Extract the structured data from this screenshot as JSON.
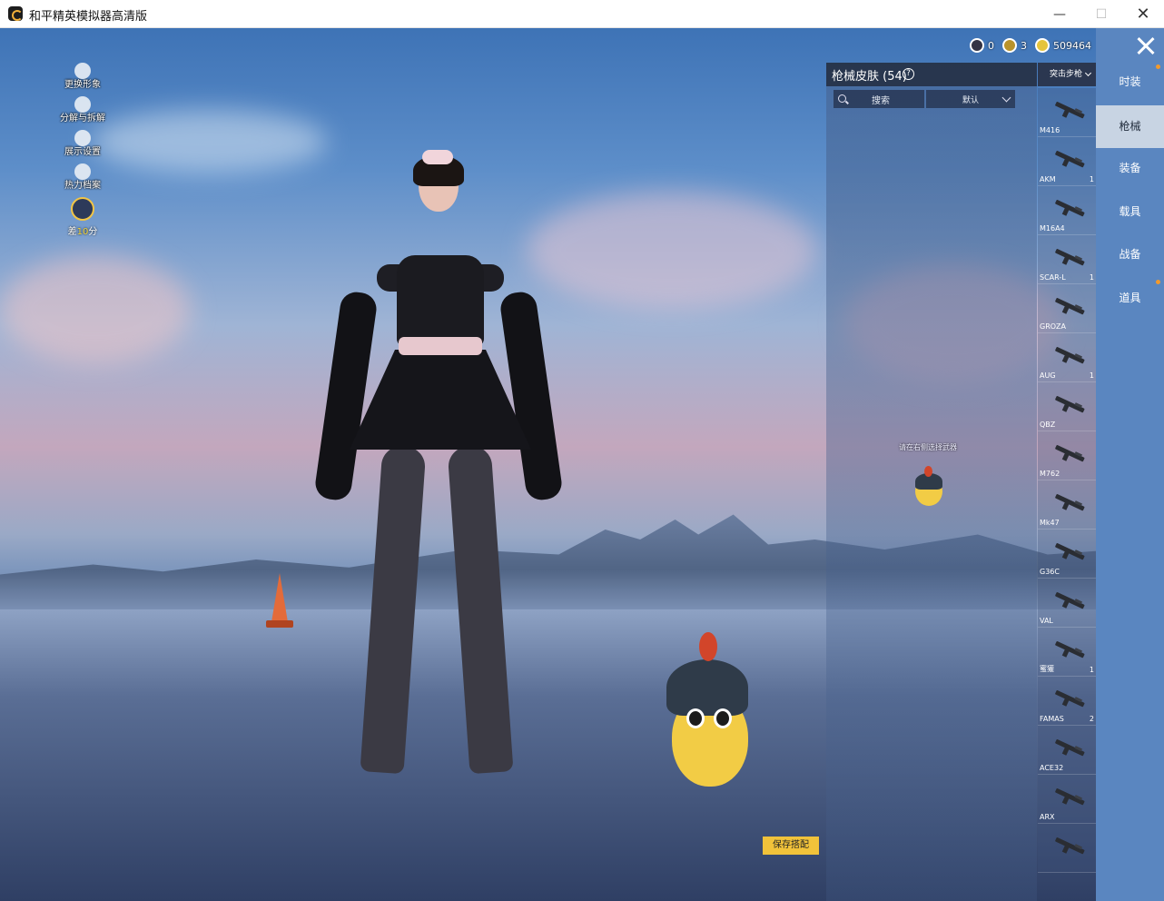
{
  "window": {
    "title": "和平精英模拟器高清版"
  },
  "currency": [
    {
      "icon": "silver-coin-icon",
      "value": "0"
    },
    {
      "icon": "gold-token-icon",
      "value": "3"
    },
    {
      "icon": "gold-coin-icon",
      "value": "509464"
    }
  ],
  "left_menu": [
    {
      "icon": "avatar-icon",
      "label": "更换形象"
    },
    {
      "icon": "puzzle-icon",
      "label": "分解与拆解"
    },
    {
      "icon": "eye-icon",
      "label": "展示设置"
    },
    {
      "icon": "fire-icon",
      "label": "热力档案"
    }
  ],
  "rank": {
    "prefix": "差",
    "points": "10",
    "suffix": "分"
  },
  "panel": {
    "title": "枪械皮肤 (54)",
    "search_label": "搜索",
    "sort_label": "默认",
    "hint": "请在右侧选择武器"
  },
  "category_select": {
    "value": "突击步枪"
  },
  "weapons": [
    {
      "name": "M416",
      "count": ""
    },
    {
      "name": "AKM",
      "count": "1"
    },
    {
      "name": "M16A4",
      "count": ""
    },
    {
      "name": "SCAR-L",
      "count": "1"
    },
    {
      "name": "GROZA",
      "count": ""
    },
    {
      "name": "AUG",
      "count": "1"
    },
    {
      "name": "QBZ",
      "count": ""
    },
    {
      "name": "M762",
      "count": ""
    },
    {
      "name": "Mk47",
      "count": ""
    },
    {
      "name": "G36C",
      "count": ""
    },
    {
      "name": "VAL",
      "count": ""
    },
    {
      "name": "蜜獾",
      "count": "1"
    },
    {
      "name": "FAMAS",
      "count": "2"
    },
    {
      "name": "ACE32",
      "count": ""
    },
    {
      "name": "ARX",
      "count": ""
    },
    {
      "name": "",
      "count": ""
    }
  ],
  "right_nav": [
    {
      "label": "时装",
      "active": false
    },
    {
      "label": "枪械",
      "active": true
    },
    {
      "label": "装备",
      "active": false
    },
    {
      "label": "载具",
      "active": false
    },
    {
      "label": "战备",
      "active": false
    },
    {
      "label": "道具",
      "active": false
    }
  ],
  "save_button": {
    "label": "保存搭配"
  },
  "colors": {
    "nav_bg": "#5a86c0",
    "nav_active_bg": "#c8d4e3",
    "save_button_bg": "#f1c23a"
  }
}
